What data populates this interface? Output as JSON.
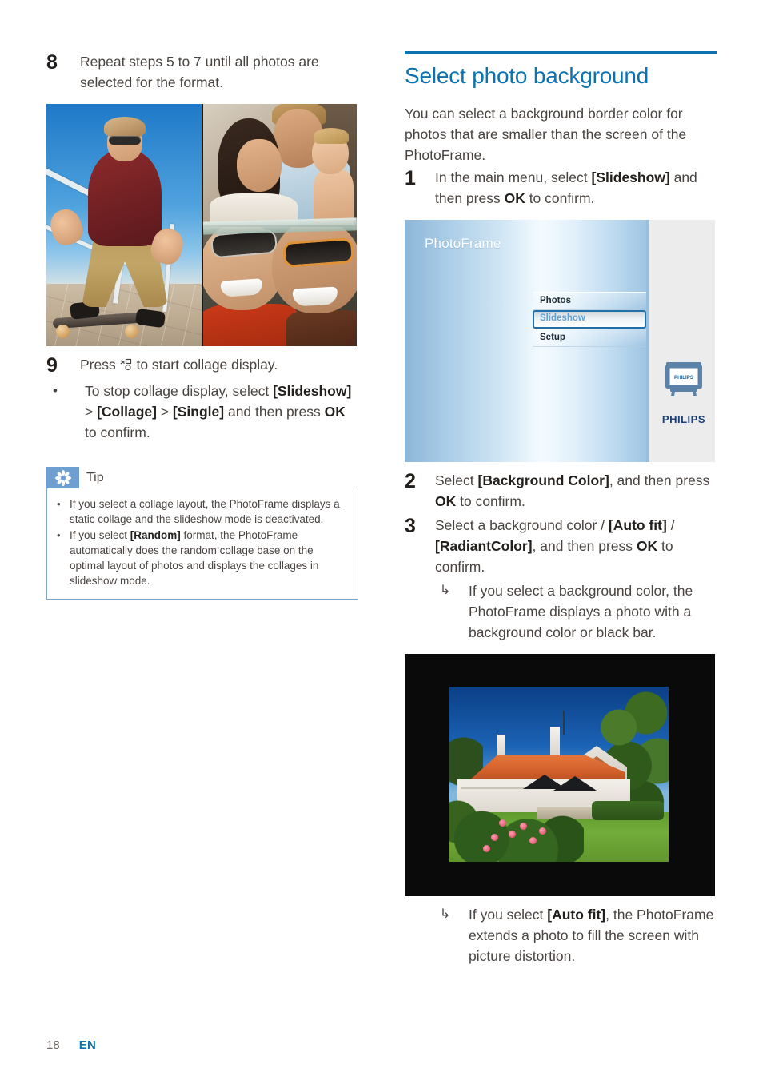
{
  "document": {
    "footer": {
      "page_number": "18",
      "language": "EN"
    }
  },
  "left_column": {
    "step8": {
      "number": "8",
      "text": "Repeat steps 5 to 7 until all photos are selected for the format."
    },
    "collage_figure": {
      "caption": "",
      "alt_name": "collage-photo-three-panels"
    },
    "step9": {
      "number": "9",
      "text_before_icon": "Press ",
      "icon": "slideshow-icon",
      "text_after_icon": " to start collage display.",
      "sub_bullet": {
        "marker": "•",
        "part1": "To stop collage display, select ",
        "bold1": "[Slideshow]",
        "sep1": " > ",
        "bold2": "[Collage]",
        "sep2": " > ",
        "bold3": "[Single]",
        "part2": " and then press ",
        "bold4": "OK",
        "part3": " to confirm."
      }
    },
    "tip": {
      "icon": "tip-asterisk-icon",
      "title": "Tip",
      "items": [
        {
          "marker": "•",
          "part1": "If you select a collage layout, the PhotoFrame displays a static collage and the slideshow mode is deactivated.",
          "bold1": "",
          "part2": ""
        },
        {
          "marker": "•",
          "part1": "If you select ",
          "bold1": "[Random]",
          "part2": " format, the PhotoFrame automatically does the random collage base on the optimal layout of photos and displays the collages in slideshow mode."
        }
      ]
    }
  },
  "right_column": {
    "heading": "Select photo background",
    "heading_color": "#0c72b0",
    "intro": "You can select a background border color for photos that are smaller than the screen of the PhotoFrame.",
    "step1": {
      "number": "1",
      "part1": "In the main menu, select ",
      "bold1": "[Slideshow]",
      "part2": " and then press ",
      "bold2": "OK",
      "part3": " to confirm."
    },
    "photoframe_screenshot": {
      "title": "PhotoFrame",
      "menu_items": [
        {
          "label": "Photos",
          "selected": false
        },
        {
          "label": "Slideshow",
          "selected": true
        },
        {
          "label": "Setup",
          "selected": false
        }
      ],
      "device_icon": "photoframe-device-icon",
      "device_screen_text": "PHILIPS",
      "brand_logo": "PHILIPS"
    },
    "step2": {
      "number": "2",
      "part1": "Select ",
      "bold1": "[Background Color]",
      "part2": ", and then press ",
      "bold2": "OK",
      "part3": " to confirm."
    },
    "step3": {
      "number": "3",
      "part1": "Select a background color / ",
      "bold1": "[Auto fit]",
      "part2": " / ",
      "bold2": "[RadiantColor]",
      "part3": ", and then press ",
      "bold3": "OK",
      "part4": " to confirm.",
      "result": {
        "marker": "↳",
        "text": "If you select a background color, the PhotoFrame displays a photo with a background color or black bar."
      }
    },
    "house_figure": {
      "alt_name": "photo-with-black-bars"
    },
    "step3_result2": {
      "marker": "↳",
      "part1": "If you select ",
      "bold1": "[Auto fit]",
      "part2": ", the PhotoFrame extends a photo to fill the screen with picture distortion."
    }
  }
}
